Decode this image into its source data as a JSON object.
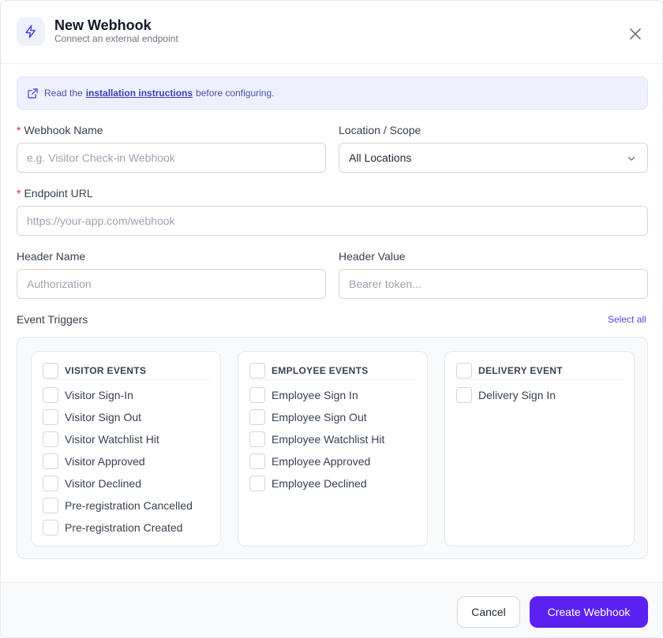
{
  "header": {
    "title": "New Webhook",
    "subtitle": "Connect an external endpoint",
    "icon": "lightning-icon",
    "close_icon": "close-icon"
  },
  "banner": {
    "prefix": "Read the",
    "link": "installation instructions",
    "suffix": "before configuring.",
    "icon": "external-link-icon"
  },
  "form": {
    "webhook_name": {
      "label": "Webhook Name",
      "required": true,
      "value": "",
      "placeholder": "e.g. Visitor Check-in Webhook"
    },
    "location_scope": {
      "label": "Location / Scope",
      "selected": "All Locations"
    },
    "endpoint_url": {
      "label": "Endpoint URL",
      "required": true,
      "value": "",
      "placeholder": "https://your-app.com/webhook"
    },
    "header_name": {
      "label": "Header Name",
      "value": "",
      "placeholder": "Authorization"
    },
    "header_value": {
      "label": "Header Value",
      "value": "",
      "placeholder": "Bearer token..."
    }
  },
  "triggers": {
    "label": "Event Triggers",
    "select_all": "Select all",
    "groups": [
      {
        "title": "VISITOR EVENTS",
        "items": [
          "Visitor Sign-In",
          "Visitor Sign Out",
          "Visitor Watchlist Hit",
          "Visitor Approved",
          "Visitor Declined",
          "Pre-registration Cancelled",
          "Pre-registration Created"
        ]
      },
      {
        "title": "EMPLOYEE EVENTS",
        "items": [
          "Employee Sign In",
          "Employee Sign Out",
          "Employee Watchlist Hit",
          "Employee Approved",
          "Employee Declined"
        ]
      },
      {
        "title": "DELIVERY EVENT",
        "items": [
          "Delivery Sign In"
        ]
      }
    ]
  },
  "footer": {
    "cancel": "Cancel",
    "create": "Create Webhook"
  },
  "colors": {
    "accent": "#5b21f0",
    "banner_bg": "#eef0fd",
    "required": "#e11d48"
  }
}
